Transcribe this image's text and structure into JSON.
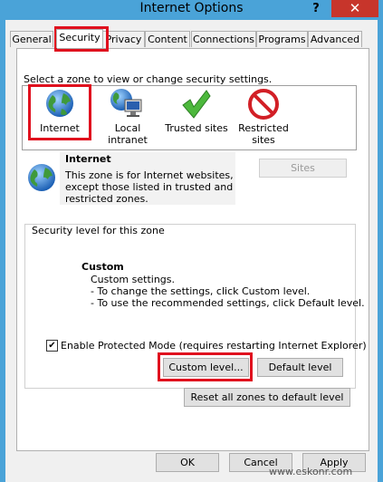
{
  "window": {
    "title": "Internet Options",
    "help_label": "?",
    "close_label": "✕"
  },
  "tabs": [
    {
      "label": "General"
    },
    {
      "label": "Security"
    },
    {
      "label": "Privacy"
    },
    {
      "label": "Content"
    },
    {
      "label": "Connections"
    },
    {
      "label": "Programs"
    },
    {
      "label": "Advanced"
    }
  ],
  "security": {
    "zone_prompt": "Select a zone to view or change security settings.",
    "zones": [
      {
        "label_1": "Internet",
        "label_2": "",
        "icon": "globe-icon"
      },
      {
        "label_1": "Local intranet",
        "label_2": "",
        "icon": "local-intranet-icon"
      },
      {
        "label_1": "Trusted sites",
        "label_2": "",
        "icon": "checkmark-icon"
      },
      {
        "label_1": "Restricted",
        "label_2": "sites",
        "icon": "restricted-icon"
      }
    ],
    "selected_zone": {
      "title": "Internet",
      "desc_1": "This zone is for Internet websites,",
      "desc_2": "except those listed in trusted and",
      "desc_3": "restricted zones."
    },
    "sites_button": "Sites",
    "level_group_title": "Security level for this zone",
    "level": {
      "title": "Custom",
      "line_1": "Custom settings.",
      "line_2": "- To change the settings, click Custom level.",
      "line_3": "- To use the recommended settings, click Default level."
    },
    "protected_mode_label": "Enable Protected Mode (requires restarting Internet Explorer)",
    "protected_mode_checked": "✔",
    "custom_level_button": "Custom level...",
    "default_level_button": "Default level",
    "reset_all_button": "Reset all zones to default level"
  },
  "footer": {
    "ok": "OK",
    "cancel": "Cancel",
    "apply": "Apply"
  },
  "watermark": "www.eskonr.com",
  "colors": {
    "titlebar": "#4aa3d8",
    "close": "#c7352b",
    "highlight": "#e0101e"
  }
}
